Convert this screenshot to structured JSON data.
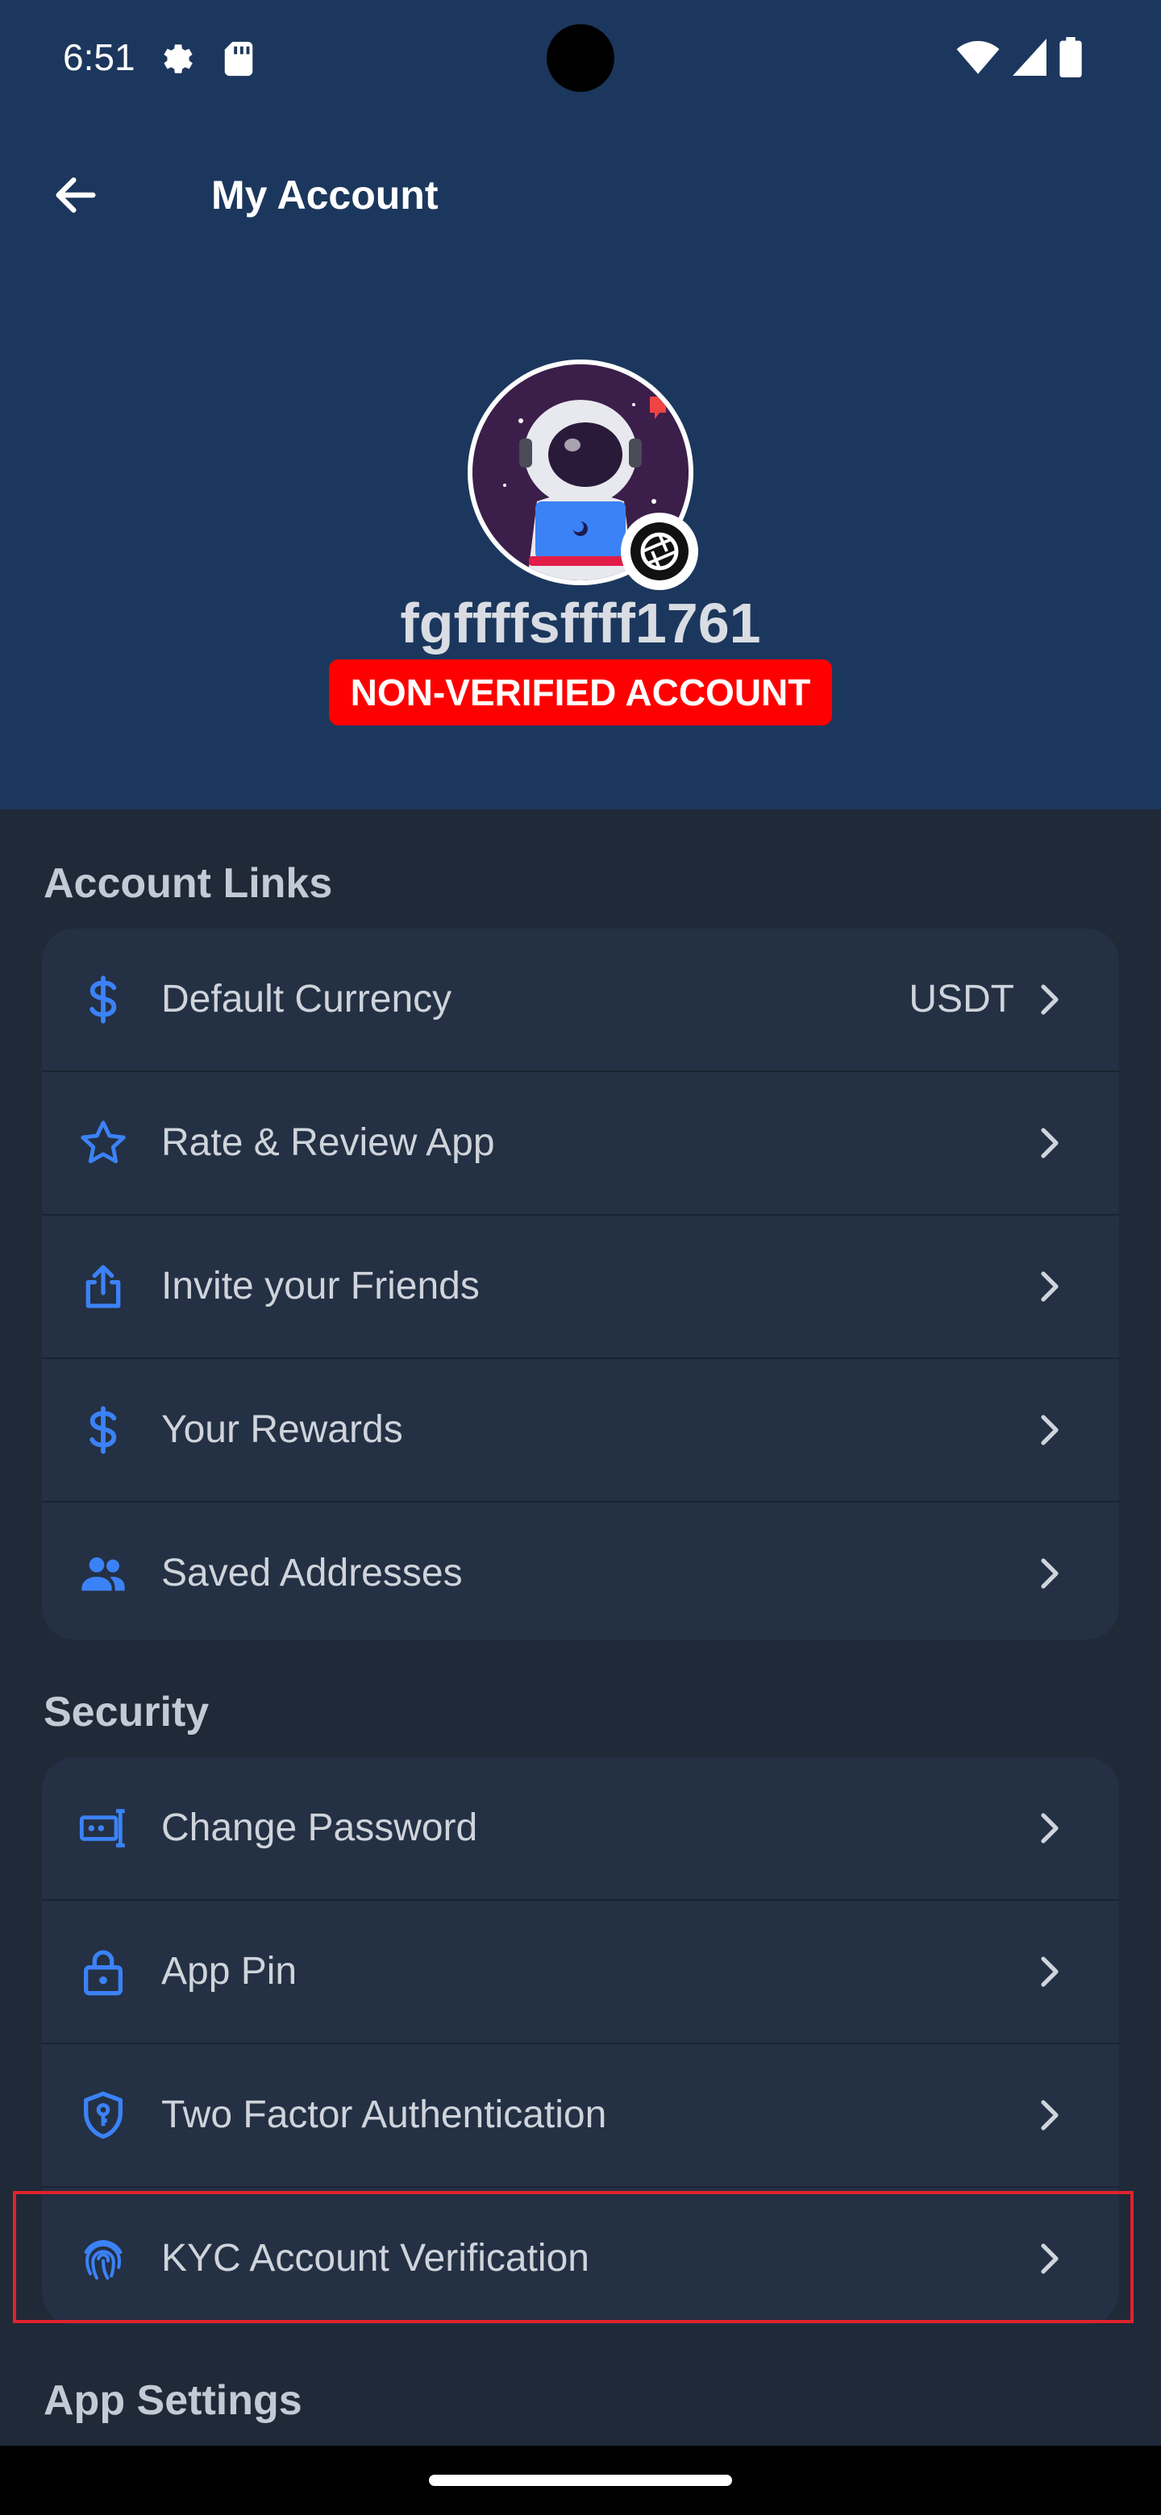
{
  "status_bar": {
    "time": "6:51",
    "icons": [
      "gear-icon",
      "sd-card-icon",
      "wifi-icon",
      "signal-icon",
      "battery-icon"
    ]
  },
  "header": {
    "title": "My Account",
    "back_icon": "arrow-left-icon"
  },
  "profile": {
    "username": "fgffffsffff1761",
    "verification_status": "NON-VERIFIED ACCOUNT",
    "badge_color": "#ff0000"
  },
  "account_links": {
    "title": "Account Links",
    "items": [
      {
        "label": "Default Currency",
        "value": "USDT",
        "icon": "dollar-icon"
      },
      {
        "label": "Rate & Review App",
        "icon": "star-icon"
      },
      {
        "label": "Invite your Friends",
        "icon": "share-icon"
      },
      {
        "label": "Your Rewards",
        "icon": "dollar-icon"
      },
      {
        "label": "Saved Addresses",
        "icon": "people-icon"
      }
    ]
  },
  "security": {
    "title": "Security",
    "items": [
      {
        "label": "Change Password",
        "icon": "password-icon"
      },
      {
        "label": "App Pin",
        "icon": "lock-icon"
      },
      {
        "label": "Two Factor Authentication",
        "icon": "shield-key-icon"
      },
      {
        "label": "KYC Account Verification",
        "icon": "fingerprint-icon"
      }
    ]
  },
  "app_settings": {
    "title": "App Settings"
  },
  "colors": {
    "header_bg": "#1c375d",
    "page_bg": "#1f2938",
    "card_bg": "#243044",
    "icon_blue": "#3b82f6",
    "highlight": "#e0232b"
  }
}
